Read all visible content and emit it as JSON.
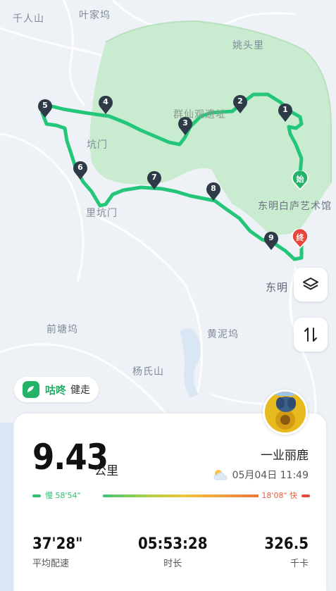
{
  "map": {
    "places": {
      "p1": "千人山",
      "p2": "叶家坞",
      "p3": "姚头里",
      "p4": "群仙观遗址",
      "p5": "坑门",
      "p6": "里坑门",
      "p7": "东明白庐艺术馆",
      "p8": "东明",
      "p9": "前塘坞",
      "p10": "黄泥坞",
      "p11": "杨氏山"
    },
    "markers": [
      "1",
      "2",
      "3",
      "4",
      "5",
      "6",
      "7",
      "8",
      "9"
    ],
    "start_label": "始",
    "end_label": "终",
    "layers_icon": "layers-icon",
    "route_icon": "route-toggle-icon",
    "colors": {
      "route": "#24c77a",
      "green_area": "#c9ebcf",
      "marker": "#2e3a47",
      "start": "#25b36a",
      "end": "#e8483b",
      "water": "#d9e6f3"
    }
  },
  "brand": {
    "name": "咕咚",
    "mode": "健走"
  },
  "summary": {
    "distance": "9.43",
    "distance_unit": "公里",
    "username": "一业丽鹿",
    "datetime": "05月04日 11:49",
    "weather_icon": "partly-cloudy-icon",
    "pace_slow_label": "慢",
    "pace_slow_value": "58'54\"",
    "pace_fast_value": "18'08\"",
    "pace_fast_label": "快",
    "stats": [
      {
        "value": "37'28\"",
        "label": "平均配速"
      },
      {
        "value": "05:53:28",
        "label": "时长"
      },
      {
        "value": "326.5",
        "label": "千卡"
      }
    ]
  }
}
